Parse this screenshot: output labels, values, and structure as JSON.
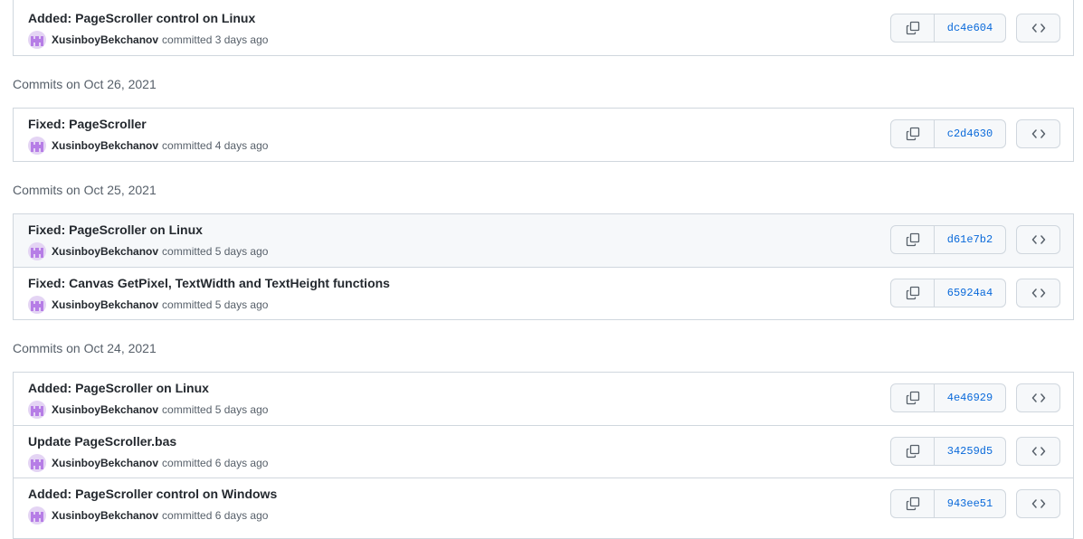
{
  "groups": [
    {
      "heading": "",
      "commits": [
        {
          "message": "Added: PageScroller control on Linux",
          "author": "XusinboyBekchanov",
          "committed": "committed 3 days ago",
          "sha": "dc4e604"
        }
      ]
    },
    {
      "heading": "Commits on Oct 26, 2021",
      "commits": [
        {
          "message": "Fixed: PageScroller",
          "author": "XusinboyBekchanov",
          "committed": "committed 4 days ago",
          "sha": "c2d4630"
        }
      ]
    },
    {
      "heading": "Commits on Oct 25, 2021",
      "commits": [
        {
          "message": "Fixed: PageScroller on Linux",
          "author": "XusinboyBekchanov",
          "committed": "committed 5 days ago",
          "sha": "d61e7b2"
        },
        {
          "message": "Fixed: Canvas GetPixel, TextWidth and TextHeight functions",
          "author": "XusinboyBekchanov",
          "committed": "committed 5 days ago",
          "sha": "65924a4"
        }
      ]
    },
    {
      "heading": "Commits on Oct 24, 2021",
      "commits": [
        {
          "message": "Added: PageScroller on Linux",
          "author": "XusinboyBekchanov",
          "committed": "committed 5 days ago",
          "sha": "4e46929"
        },
        {
          "message": "Update PageScroller.bas",
          "author": "XusinboyBekchanov",
          "committed": "committed 6 days ago",
          "sha": "34259d5"
        },
        {
          "message": "Added: PageScroller control on Windows",
          "author": "XusinboyBekchanov",
          "committed": "committed 6 days ago",
          "sha": "943ee51"
        }
      ]
    }
  ],
  "icons": {
    "copy": "copy-icon",
    "browse": "code-icon",
    "avatar": "identicon-avatar"
  },
  "colors": {
    "link": "#0969da",
    "border": "#d0d7de",
    "avatar": "#b67de6",
    "highlight_row": "#f6f8fa"
  }
}
